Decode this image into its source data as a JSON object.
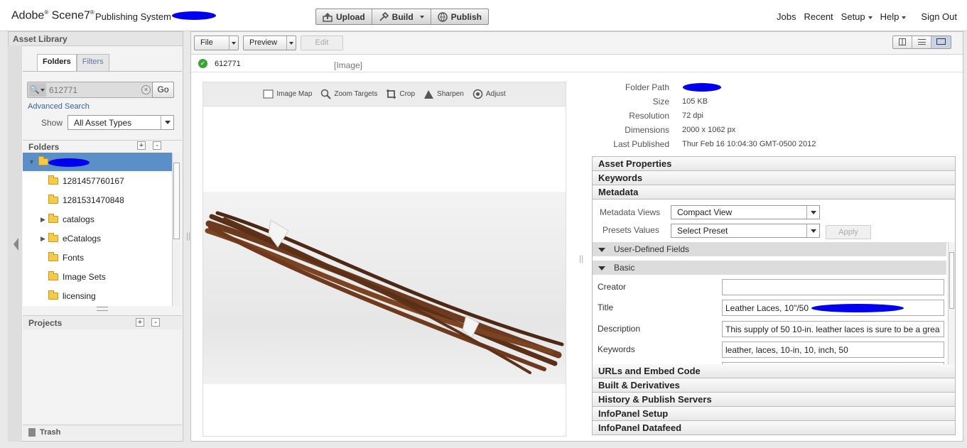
{
  "header": {
    "logo": "Adobe",
    "logo_product": "Scene7",
    "logo_mark": "®",
    "product_title": "Publishing System",
    "tools": [
      {
        "label": "Upload",
        "icon": "upload-icon"
      },
      {
        "label": "Build",
        "icon": "build-icon"
      },
      {
        "label": "Publish",
        "icon": "publish-icon"
      }
    ],
    "nav": {
      "jobs": "Jobs",
      "recent": "Recent",
      "setup": "Setup",
      "help": "Help",
      "signout": "Sign Out"
    }
  },
  "left_panel": {
    "title": "Asset Library",
    "tabs": {
      "folders": "Folders",
      "filters": "Filters"
    },
    "search": {
      "value": "612771",
      "go": "Go"
    },
    "advanced_search": "Advanced Search",
    "show_label": "Show",
    "show_value": "All Asset Types",
    "folders_header": "Folders",
    "plus": "+",
    "minus": "-",
    "tree": [
      {
        "label": ""
      },
      {
        "label": "1281457760167"
      },
      {
        "label": "1281531470848"
      },
      {
        "label": "catalogs"
      },
      {
        "label": "eCatalogs"
      },
      {
        "label": "Fonts"
      },
      {
        "label": "Image Sets"
      },
      {
        "label": "licensing"
      }
    ],
    "projects_header": "Projects",
    "trash": "Trash"
  },
  "toolbar": {
    "file": "File",
    "preview": "Preview",
    "edit": "Edit"
  },
  "asset": {
    "id": "612771",
    "type": "[Image]"
  },
  "image_tools": [
    {
      "label": "Image Map",
      "icon": "image-map-icon"
    },
    {
      "label": "Zoom Targets",
      "icon": "zoom-targets-icon"
    },
    {
      "label": "Crop",
      "icon": "crop-icon"
    },
    {
      "label": "Sharpen",
      "icon": "sharpen-icon"
    },
    {
      "label": "Adjust",
      "icon": "adjust-icon"
    }
  ],
  "info": {
    "folder_path_label": "Folder Path",
    "size_label": "Size",
    "size": "105 KB",
    "resolution_label": "Resolution",
    "resolution": "72 dpi",
    "dimensions_label": "Dimensions",
    "dimensions": "2000 x 1062 px",
    "last_published_label": "Last Published",
    "last_published": "Thur  Feb 16 10:04:30 GMT-0500 2012"
  },
  "accordion": {
    "asset_properties": "Asset Properties",
    "keywords": "Keywords",
    "metadata": "Metadata",
    "metadata_views_label": "Metadata Views",
    "metadata_views_value": "Compact View",
    "presets_label": "Presets Values",
    "presets_value": "Select Preset",
    "apply": "Apply",
    "user_defined": "User-Defined Fields",
    "basic": "Basic",
    "fields": {
      "creator_label": "Creator",
      "creator": "",
      "title_label": "Title",
      "title": "Leather Laces, 10\"/50",
      "description_label": "Description",
      "description": "This supply of 50 10-in. leather laces is sure to be a grea",
      "keywords_label": "Keywords",
      "keywords": "leather, laces, 10-in, 10, inch, 50"
    },
    "urls": "URLs and Embed Code",
    "built": "Built & Derivatives",
    "history": "History & Publish Servers",
    "infopanel_setup": "InfoPanel Setup",
    "infopanel_datafeed": "InfoPanel Datafeed"
  },
  "colors": {
    "accent": "#5a8fc7",
    "redaction": "#0000ee",
    "success": "#3aa33a"
  }
}
